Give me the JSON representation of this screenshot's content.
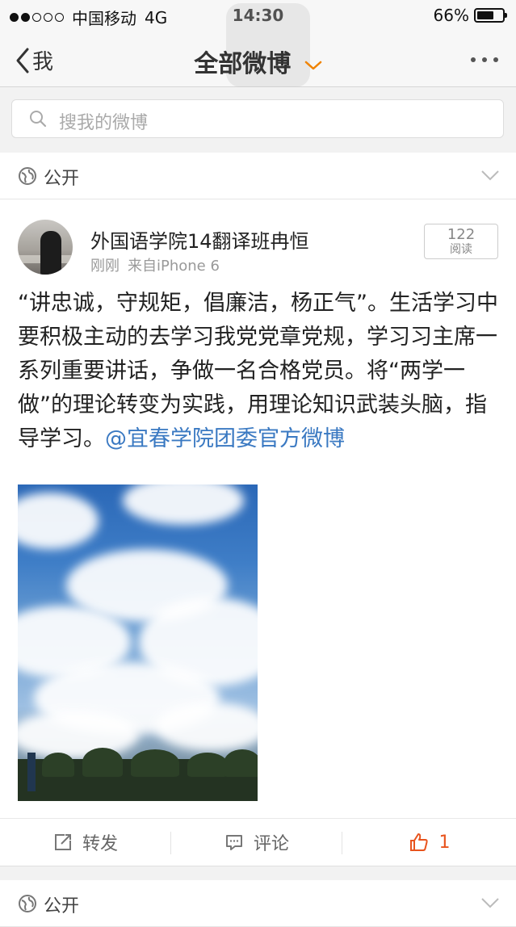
{
  "status_bar": {
    "carrier": "中国移动",
    "network": "4G",
    "time": "14:30",
    "battery_text": "66%",
    "battery_level": 0.66,
    "signal_bars": 2
  },
  "nav": {
    "back_label": "我",
    "title": "全部微博",
    "accent_color": "#f08300"
  },
  "search": {
    "placeholder": "搜我的微博"
  },
  "visibility": {
    "label": "公开"
  },
  "post": {
    "author": "外国语学院14翻译班冉恒",
    "time": "刚刚",
    "source": "来自iPhone 6",
    "read_count": "122",
    "read_label": "阅读",
    "text": "“讲忠诚，守规矩，倡廉洁，杨正气”。生活学习中要积极主动的去学习我党党章党规，学习习主席一系列重要讲话，争做一名合格党员。将“两学一做”的理论转变为实践，用理论知识武装头脑，指导学习。",
    "mention": "@宜春学院团委官方微博",
    "mention_color": "#3a79c2"
  },
  "actions": {
    "repost_label": "转发",
    "comment_label": "评论",
    "like_count": "1",
    "like_color": "#e8541e"
  },
  "next_post": {
    "visibility_label": "公开"
  }
}
